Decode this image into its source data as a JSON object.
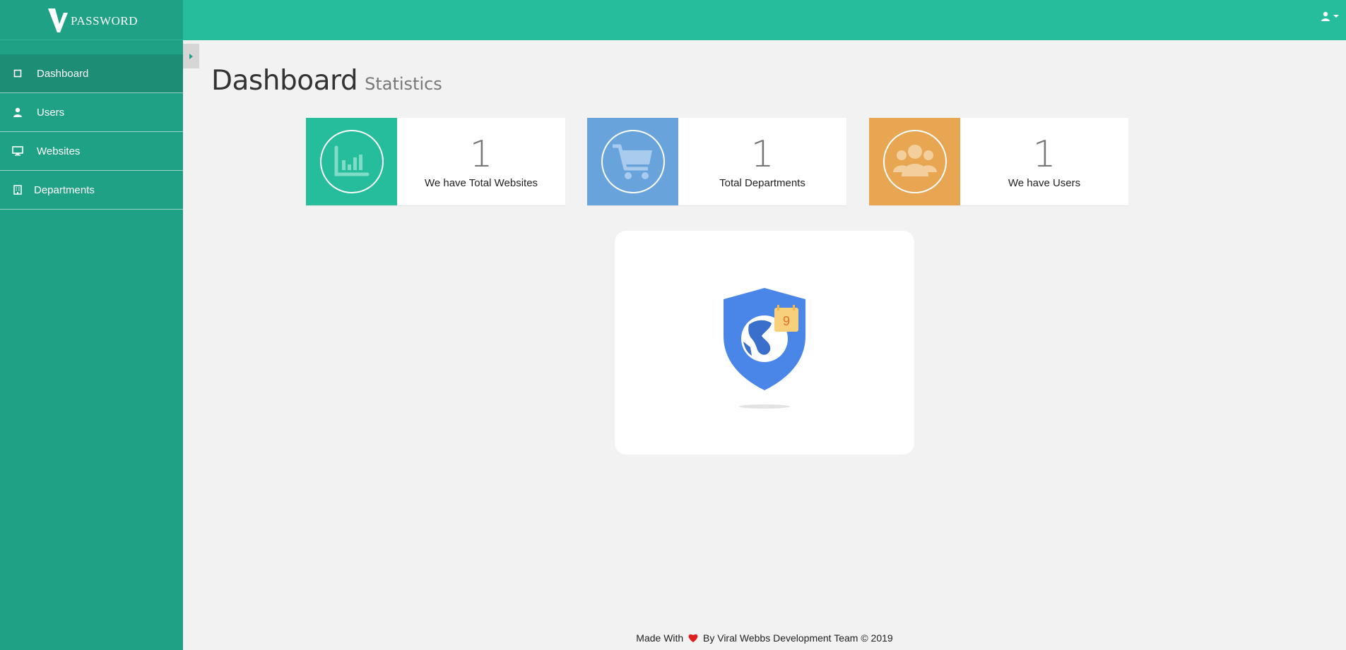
{
  "brand": {
    "letter": "V",
    "name": "PASSWORD"
  },
  "sidebar": {
    "items": [
      {
        "label": "Dashboard",
        "icon": "square-icon",
        "active": true
      },
      {
        "label": "Users",
        "icon": "user-icon"
      },
      {
        "label": "Websites",
        "icon": "desktop-icon"
      },
      {
        "label": "Departments",
        "icon": "building-icon"
      }
    ]
  },
  "header": {
    "user_icon": "user-icon"
  },
  "page": {
    "title": "Dashboard",
    "subtitle": "Statistics"
  },
  "stats": [
    {
      "value": "1",
      "label": "We have Total Websites",
      "icon": "bar-chart-icon",
      "color": "#25bd9b"
    },
    {
      "value": "1",
      "label": "Total Departments",
      "icon": "cart-icon",
      "color": "#68a3db"
    },
    {
      "value": "1",
      "label": "We have Users",
      "icon": "users-icon",
      "color": "#e8a552"
    }
  ],
  "illustration": {
    "badge_text": "9"
  },
  "footer": {
    "prefix": "Made With",
    "suffix": "By Viral Webbs Development Team © 2019"
  },
  "colors": {
    "sidebar": "#1fa185",
    "topbar": "#25bd9b",
    "active_item": "#1d8d75",
    "heart": "#e02020",
    "shield": "#4a86e8"
  }
}
